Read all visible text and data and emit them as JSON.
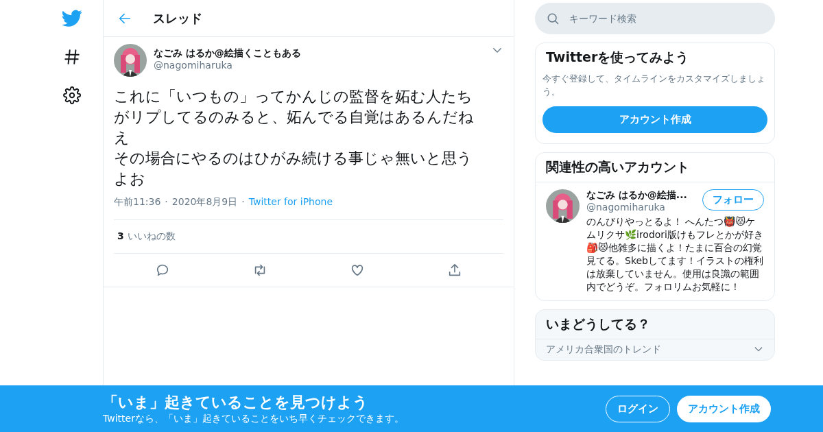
{
  "header": {
    "title": "スレッド"
  },
  "tweet": {
    "name": "なごみ はるか@絵描くこともある",
    "handle": "@nagomiharuka",
    "lines": [
      "これに「いつもの」ってかんじの監督を妬む人たちがリプしてるのみると、妬んでる自覚はあるんだねえ",
      "その場合にやるのはひがみ続ける事じゃ無いと思うよお"
    ],
    "meta": [
      {
        "kind": "time",
        "text": "午前11:36"
      },
      {
        "kind": "separator",
        "text": "·"
      },
      {
        "kind": "date",
        "text": "2020年8月9日"
      },
      {
        "kind": "separator",
        "text": "·"
      },
      {
        "kind": "link",
        "text": "Twitter for iPhone"
      }
    ],
    "likes_count": "3",
    "likes_label": "いいねの数"
  },
  "search": {
    "placeholder": "キーワード検索"
  },
  "signup": {
    "title": "Twitterを使ってみよう",
    "text": "今すぐ登録して、タイムラインをカスタマイズしましょう。",
    "button": "アカウント作成"
  },
  "related": {
    "title": "関連性の高いアカウント",
    "accounts": [
      {
        "name": "なごみ はるか@絵描...",
        "handle": "@nagomiharuka",
        "follow": "フォロー",
        "bio": "のんびりやっとるよ！ へんたつ👹😾ケムリクサ🌿irodori版けもフレとかが好き🎒😾他雑多に描くよ！たまに百合の幻覚見てる。Skebしてます！イラストの権利は放棄していません。使用は良識の範囲内でどうぞ。フォロリムお気軽に！"
      }
    ]
  },
  "trends": {
    "title": "いまどうしてる？",
    "subtitle": "アメリカ合衆国のトレンド"
  },
  "banner": {
    "title": "「いま」起きていることを見つけよう",
    "text": "Twitterなら、「いま」起きていることをいち早くチェックできます。",
    "login": "ログイン",
    "signup": "アカウント作成"
  }
}
